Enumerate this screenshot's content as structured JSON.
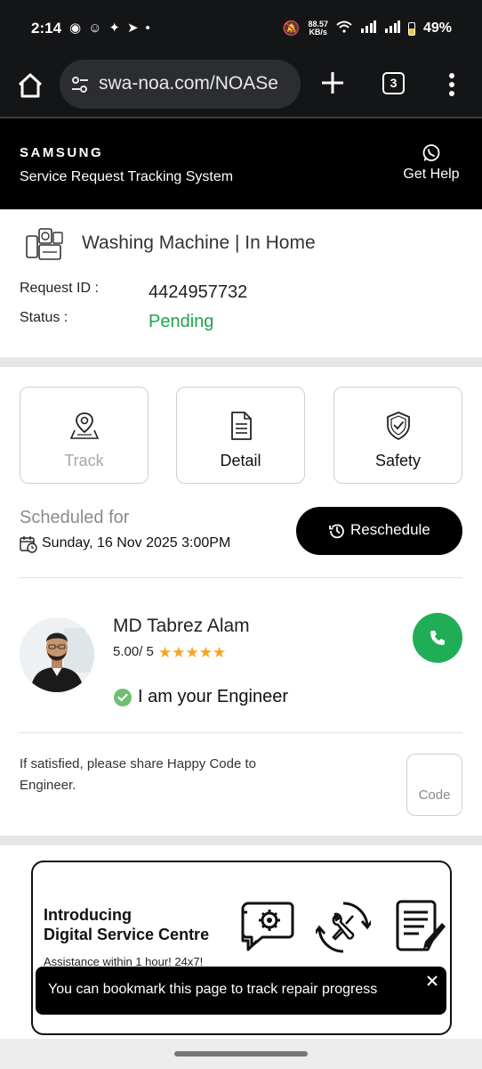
{
  "status_bar": {
    "time": "2:14",
    "net_speed_value": "88.57",
    "net_speed_unit": "KB/s",
    "battery": "49%"
  },
  "browser": {
    "url": "swa-noa.com/NOASe",
    "tab_count": "3"
  },
  "header": {
    "brand": "SAMSUNG",
    "subtitle": "Service Request Tracking System",
    "help_label": "Get Help"
  },
  "request": {
    "product_title": "Washing Machine | In Home",
    "request_id_label": "Request ID :",
    "request_id_value": "4424957732",
    "status_label": "Status :",
    "status_value": "Pending",
    "status_color": "#1fa34a"
  },
  "actions": {
    "track_label": "Track",
    "detail_label": "Detail",
    "safety_label": "Safety"
  },
  "schedule": {
    "title": "Scheduled for",
    "datetime": "Sunday, 16 Nov 2025 3:00PM",
    "reschedule_label": "Reschedule"
  },
  "engineer": {
    "name": "MD Tabrez Alam",
    "rating": "5.00/ 5",
    "stars": "★★★★★",
    "star_rating": 5,
    "tagline": "I am your Engineer",
    "call_color": "#1fae55"
  },
  "happy_code": {
    "message": "If satisfied, please share Happy Code to Engineer.",
    "code_label": "Code"
  },
  "promo": {
    "title_line1": "Introducing",
    "title_line2": "Digital Service Centre",
    "subtitle": "Assistance within 1 hour! 24x7!"
  },
  "toast": {
    "message": "You can bookmark this page to track repair progress"
  }
}
